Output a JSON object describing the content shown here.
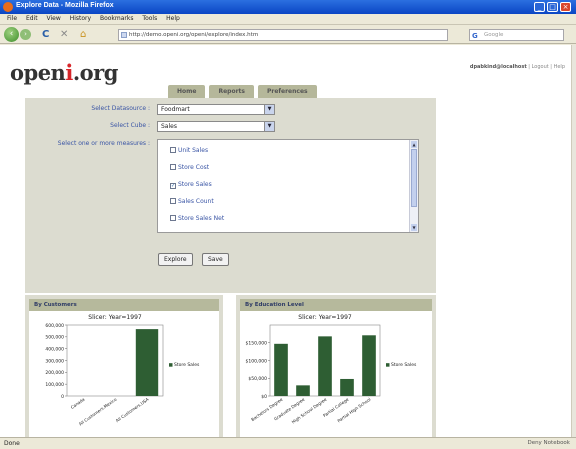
{
  "window": {
    "title": "Explore Data - Mozilla Firefox",
    "controls": [
      "_",
      "□",
      "×"
    ]
  },
  "menu": [
    "File",
    "Edit",
    "View",
    "History",
    "Bookmarks",
    "Tools",
    "Help"
  ],
  "toolbar": {
    "back": "‹",
    "forward": "›",
    "reload": "C",
    "stop": "✕",
    "home": "⌂",
    "url": "http://demo.openi.org/openi/explore/index.htm",
    "search_engine": "G",
    "search_placeholder": "Google"
  },
  "site": {
    "logo_prefix": "open",
    "logo_x": "i",
    "logo_suffix": ".org"
  },
  "user": {
    "name": "dpabkind@localhost",
    "logout": "Logout",
    "help": "Help"
  },
  "tabs": [
    "Home",
    "Reports",
    "Preferences"
  ],
  "form": {
    "datasource_label": "Select Datasource :",
    "datasource_value": "Foodmart",
    "cube_label": "Select Cube :",
    "cube_value": "Sales",
    "measures_label": "Select one or more measures :",
    "measures": [
      {
        "label": "Unit Sales",
        "checked": false
      },
      {
        "label": "Store Cost",
        "checked": false
      },
      {
        "label": "Store Sales",
        "checked": true
      },
      {
        "label": "Sales Count",
        "checked": false
      },
      {
        "label": "Store Sales Net",
        "checked": false
      }
    ],
    "explore_button": "Explore",
    "save_button": "Save"
  },
  "charts": [
    {
      "panel_title": "By Customers",
      "chart_data": {
        "type": "bar",
        "title": "Slicer: Year=1997",
        "categories": [
          "Canada",
          "All Customers.Mexico",
          "All Customers.USA"
        ],
        "values": [
          0,
          0,
          565238
        ],
        "ylim": [
          0,
          600000
        ],
        "yticks": [
          "0",
          "100,000",
          "200,000",
          "300,000",
          "400,000",
          "500,000",
          "600,000"
        ],
        "legend": "Store Sales",
        "legend_position": "right",
        "bar_color": "#2e5e33"
      }
    },
    {
      "panel_title": "By Education Level",
      "chart_data": {
        "type": "bar",
        "title": "Slicer: Year=1997",
        "categories": [
          "Bachelors Degree",
          "Graduate Degree",
          "High School Degree",
          "Partial College",
          "Partial High School"
        ],
        "values": [
          147000,
          30000,
          168000,
          48000,
          171000
        ],
        "ylim": [
          0,
          200000
        ],
        "yticks": [
          "$0",
          "$50,000",
          "$100,000",
          "$150,000"
        ],
        "legend": "Store Sales",
        "legend_position": "right",
        "bar_color": "#2e5e33"
      }
    }
  ],
  "status": {
    "text": "Done",
    "right_text": "Deny Notebook"
  }
}
